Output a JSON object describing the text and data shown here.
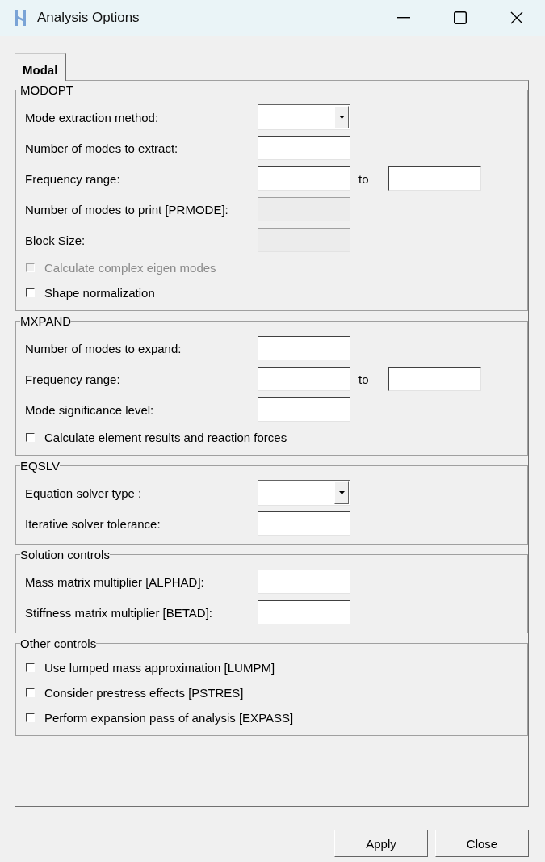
{
  "window": {
    "title": "Analysis Options"
  },
  "tabs": [
    {
      "label": "Modal",
      "selected": true
    }
  ],
  "groups": [
    {
      "title": "MODOPT",
      "rows": [
        {
          "kind": "select",
          "label": "Mode extraction method:",
          "disabled": false
        },
        {
          "kind": "text",
          "label": "Number of modes to extract:",
          "disabled": false
        },
        {
          "kind": "range",
          "label": "Frequency range:",
          "to": "to",
          "disabled": false
        },
        {
          "kind": "text",
          "label": "Number of modes to print [PRMODE]:",
          "disabled": true
        },
        {
          "kind": "text",
          "label": "Block Size:",
          "disabled": true
        },
        {
          "kind": "checkbox",
          "label": "Calculate complex eigen modes",
          "checked": false,
          "disabled": true
        },
        {
          "kind": "checkbox",
          "label": "Shape normalization",
          "checked": false,
          "disabled": false
        }
      ]
    },
    {
      "title": "MXPAND",
      "rows": [
        {
          "kind": "text",
          "label": "Number of modes to expand:",
          "disabled": false
        },
        {
          "kind": "range",
          "label": "Frequency range:",
          "to": "to",
          "disabled": false
        },
        {
          "kind": "text",
          "label": "Mode significance level:",
          "disabled": false
        },
        {
          "kind": "checkbox",
          "label": "Calculate element results and reaction forces",
          "checked": false,
          "disabled": false
        }
      ]
    },
    {
      "title": "EQSLV",
      "rows": [
        {
          "kind": "select",
          "label": "Equation solver type :",
          "disabled": false
        },
        {
          "kind": "text",
          "label": "Iterative solver tolerance:",
          "disabled": false
        }
      ]
    },
    {
      "title": "Solution controls",
      "rows": [
        {
          "kind": "text",
          "label": "Mass matrix multiplier [ALPHAD]:",
          "disabled": false
        },
        {
          "kind": "text",
          "label": "Stiffness matrix multiplier [BETAD]:",
          "disabled": false
        }
      ]
    },
    {
      "title": "Other controls",
      "rows": [
        {
          "kind": "checkbox",
          "label": "Use lumped mass approximation [LUMPM]",
          "checked": false,
          "disabled": false
        },
        {
          "kind": "checkbox",
          "label": "Consider prestress effects [PSTRES]",
          "checked": false,
          "disabled": false
        },
        {
          "kind": "checkbox",
          "label": "Perform expansion pass of analysis [EXPASS]",
          "checked": false,
          "disabled": false
        }
      ]
    }
  ],
  "buttons": [
    "Apply",
    "Close"
  ]
}
